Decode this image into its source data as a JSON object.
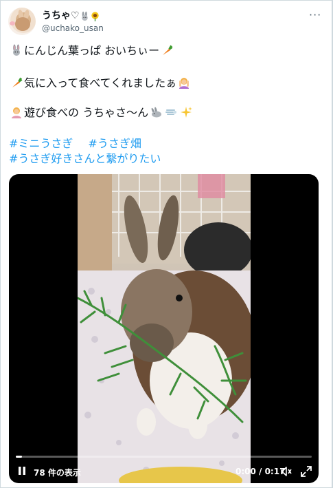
{
  "tweet": {
    "display_name": "うちゃ♡",
    "handle": "@uchako_usan",
    "more_label": "···",
    "lines": {
      "line1": "にんじん葉っぱ おいちぃー",
      "line2": "気に入って食べてくれましたぁ",
      "line3_a": "遊び食べの うちゃさ〜ん"
    },
    "hashtags": {
      "tag1": "#ミニうさぎ",
      "tag2": "#うさぎ畑",
      "tag3": "#うさぎ好きさんと繋がりたい"
    }
  },
  "video": {
    "views_label": "78 件の表示",
    "time_label": "0:00 / 0:17",
    "progress": 0.02
  },
  "icons": [
    "rabbit-icon",
    "carrot-icon",
    "woman-gesturing-icon",
    "sparkles-icon",
    "sunflower-icon",
    "more-icon",
    "pause-icon",
    "volume-icon",
    "fullscreen-icon"
  ],
  "colors": {
    "link": "#1d9bf0",
    "text": "#0f1419",
    "muted": "#536471"
  }
}
